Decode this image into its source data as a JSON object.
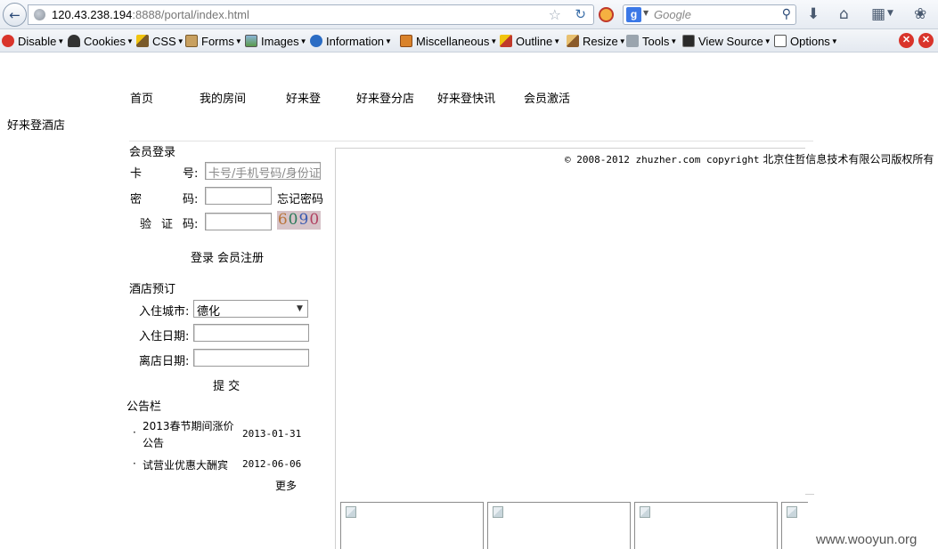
{
  "browser": {
    "url_host": "120.43.238.194",
    "url_rest": ":8888/portal/index.html",
    "search_engine_letter": "g",
    "search_placeholder": "Google",
    "dev_toolbar": [
      "Disable",
      "Cookies",
      "CSS",
      "Forms",
      "Images",
      "Information",
      "Miscellaneous",
      "Outline",
      "Resize",
      "Tools",
      "View Source",
      "Options"
    ]
  },
  "page": {
    "nav": [
      "首页",
      "我的房间",
      "好来登",
      "好来登分店",
      "好来登快讯",
      "会员激活"
    ],
    "site_title": "好来登酒店",
    "login": {
      "heading": "会员登录",
      "card_label_1": "卡",
      "card_label_2": "号:",
      "card_placeholder": "卡号/手机号码/身份证",
      "password_label_1": "密",
      "password_label_2": "码:",
      "forgot_password": "忘记密码",
      "captcha_label_1": "验",
      "captcha_label_2": "证",
      "captcha_label_3": "码:",
      "captcha_digits": [
        "6",
        "0",
        "9",
        "0"
      ],
      "login_button": "登录",
      "register_link": "会员注册"
    },
    "booking": {
      "heading": "酒店预订",
      "city_label": "入住城市:",
      "city_selected": "德化",
      "checkin_label": "入住日期:",
      "checkout_label": "离店日期:",
      "submit_button": "提 交"
    },
    "notices": {
      "heading": "公告栏",
      "items": [
        {
          "title_line1": "2013春节期间涨价",
          "title_line2": "公告",
          "date": "2013-01-31"
        },
        {
          "title_line1": "试营业优惠大酬宾",
          "title_line2": "",
          "date": "2012-06-06"
        }
      ],
      "more_link": "更多"
    },
    "copyright_prefix": "© 2008-2012 zhuzher.com copyright",
    "copyright_company": "北京住哲信息技术有限公司版权所有",
    "watermark": "www.wooyun.org"
  }
}
